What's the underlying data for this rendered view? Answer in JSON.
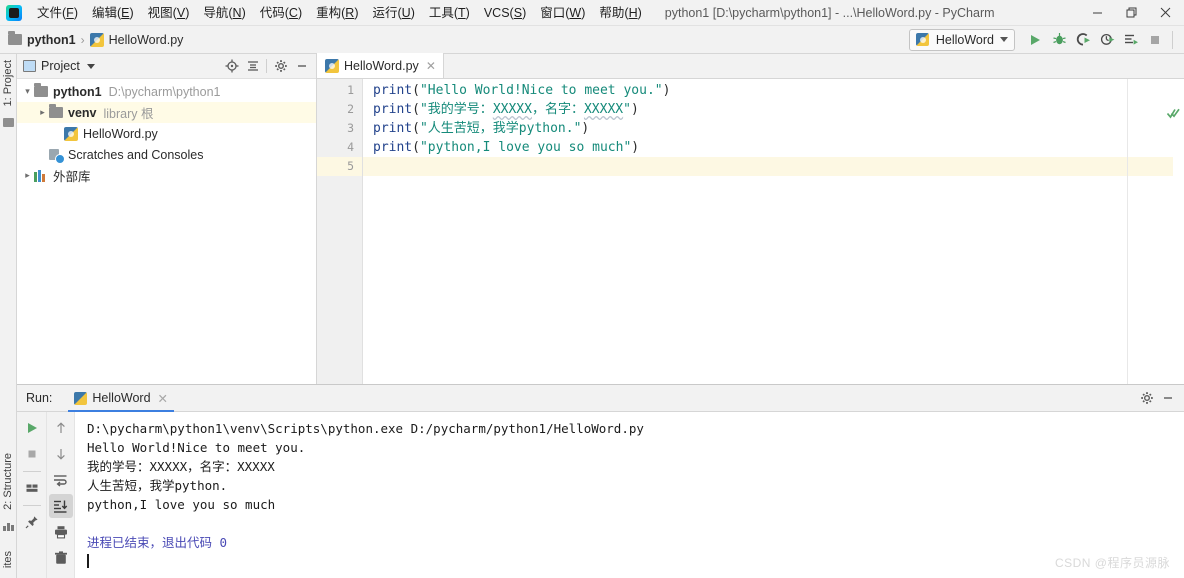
{
  "titlebar": {
    "logo_icon": "pycharm-logo-icon",
    "window_title": "python1 [D:\\pycharm\\python1] - ...\\HelloWord.py - PyCharm",
    "menus": [
      {
        "pre": "文件(",
        "key": "F",
        "post": ")"
      },
      {
        "pre": "编辑(",
        "key": "E",
        "post": ")"
      },
      {
        "pre": "视图(",
        "key": "V",
        "post": ")"
      },
      {
        "pre": "导航(",
        "key": "N",
        "post": ")"
      },
      {
        "pre": "代码(",
        "key": "C",
        "post": ")"
      },
      {
        "pre": "重构(",
        "key": "R",
        "post": ")"
      },
      {
        "pre": "运行(",
        "key": "U",
        "post": ")"
      },
      {
        "pre": "工具(",
        "key": "T",
        "post": ")"
      },
      {
        "pre": "VCS(",
        "key": "S",
        "post": ")"
      },
      {
        "pre": "窗口(",
        "key": "W",
        "post": ")"
      },
      {
        "pre": "帮助(",
        "key": "H",
        "post": ")"
      }
    ],
    "minimize_label": "—",
    "restore_label": "❐",
    "close_label": "✕"
  },
  "toolbar": {
    "breadcrumb": {
      "project": "python1",
      "separator": "›",
      "file": "HelloWord.py"
    },
    "run_config": {
      "name": "HelloWord",
      "icon": "python-file-icon"
    },
    "buttons": [
      {
        "name": "run-button",
        "icon": "run-icon"
      },
      {
        "name": "debug-button",
        "icon": "debug-icon"
      },
      {
        "name": "run-with-coverage-button",
        "icon": "coverage-icon"
      },
      {
        "name": "profile-button",
        "icon": "profile-icon"
      },
      {
        "name": "run-with-params-button",
        "icon": "run-params-icon"
      },
      {
        "name": "stop-button",
        "icon": "stop-icon"
      }
    ]
  },
  "left_strip": {
    "project_label": "1: Project",
    "structure_label": "2: Structure",
    "favorites_label": "ites"
  },
  "project_panel": {
    "title": "Project",
    "header_icons": [
      "locate-icon",
      "collapse-all-icon",
      "gear-icon",
      "minimize-icon"
    ],
    "tree": [
      {
        "indent": 0,
        "arrow": "open",
        "icon": "folder-icon",
        "label": "python1",
        "sub": "D:\\pycharm\\python1",
        "bold": true,
        "selected": false
      },
      {
        "indent": 1,
        "arrow": "closed",
        "icon": "folder-icon",
        "label": "venv",
        "sub": "library 根",
        "bold": true,
        "selected": true
      },
      {
        "indent": 2,
        "arrow": "none",
        "icon": "python-file-icon",
        "label": "HelloWord.py",
        "sub": "",
        "bold": false,
        "selected": false
      },
      {
        "indent": 1,
        "arrow": "none",
        "icon": "scratches-icon",
        "label": "Scratches and Consoles",
        "sub": "",
        "bold": false,
        "selected": false
      },
      {
        "indent": 0,
        "arrow": "closed",
        "icon": "library-icon",
        "label": "外部库",
        "sub": "",
        "bold": false,
        "selected": false
      }
    ]
  },
  "editor": {
    "tab": {
      "label": "HelloWord.py",
      "close": "✕",
      "icon": "python-file-icon"
    },
    "inspection_status_icon": "inspection-ok-check-icon",
    "line_numbers": [
      "1",
      "2",
      "3",
      "4",
      "5"
    ],
    "current_line": 5,
    "lines": [
      {
        "n": 1,
        "fn": "print",
        "open": "(\"",
        "text": "Hello World!Nice to meet you.",
        "close": "\")",
        "typo": ""
      },
      {
        "n": 2,
        "fn": "print",
        "open": "(\"",
        "text": "我的学号：XXXXX，名字：XXXXX",
        "close": "\")",
        "typo": "XXXXX"
      },
      {
        "n": 3,
        "fn": "print",
        "open": "(\"",
        "text": "人生苦短，我学python.",
        "close": "\")",
        "typo": ""
      },
      {
        "n": 4,
        "fn": "print",
        "open": "(\"",
        "text": "python,I love you so much",
        "close": "\")",
        "typo": ""
      },
      {
        "n": 5,
        "fn": "",
        "open": "",
        "text": "",
        "close": "",
        "typo": ""
      }
    ]
  },
  "run_panel": {
    "label": "Run:",
    "tab": {
      "label": "HelloWord",
      "close": "✕",
      "icon": "python-run-icon"
    },
    "header_icons": [
      "gear-icon",
      "minimize-icon"
    ],
    "left_tools": [
      {
        "name": "rerun-button",
        "icon": "run-icon"
      },
      {
        "name": "stop-button",
        "icon": "stop-icon"
      },
      {
        "name": "console-view-button",
        "icon": "console-icon"
      },
      {
        "name": "pin-tab-button",
        "icon": "pin-icon"
      }
    ],
    "right_tools": [
      {
        "name": "up-stacktrace-button",
        "icon": "arrow-up-icon"
      },
      {
        "name": "down-stacktrace-button",
        "icon": "arrow-down-icon"
      },
      {
        "name": "soft-wrap-button",
        "icon": "soft-wrap-icon"
      },
      {
        "name": "scroll-to-end-button",
        "icon": "scroll-to-end-icon"
      },
      {
        "name": "print-button",
        "icon": "printer-icon"
      },
      {
        "name": "clear-all-button",
        "icon": "trash-icon"
      }
    ],
    "output": [
      {
        "text": "D:\\pycharm\\python1\\venv\\Scripts\\python.exe D:/pycharm/python1/HelloWord.py",
        "accent": false
      },
      {
        "text": "Hello World!Nice to meet you.",
        "accent": false
      },
      {
        "text": "我的学号：XXXXX，名字：XXXXX",
        "accent": false
      },
      {
        "text": "人生苦短，我学python.",
        "accent": false
      },
      {
        "text": "python,I love you so much",
        "accent": false
      },
      {
        "text": "",
        "accent": false
      },
      {
        "text": "进程已结束，退出代码 0",
        "accent": true
      }
    ]
  },
  "watermark": "CSDN @程序员源脉",
  "colors": {
    "accent_blue": "#3c7fe0",
    "run_green": "#59a869",
    "string_teal": "#158a7a",
    "keyword_navy": "#23438c",
    "console_accent": "#4a4ab5",
    "selection_cream": "#fffbe6",
    "caret_row": "#fdf8e3"
  }
}
